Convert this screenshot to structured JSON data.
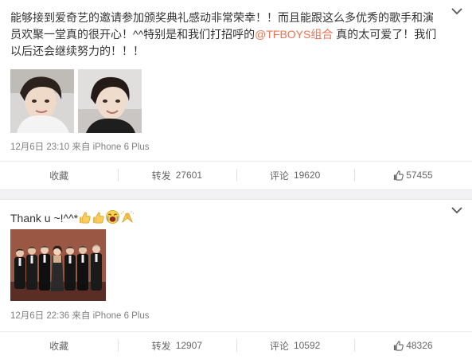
{
  "post1": {
    "text_part1": "能够接到爱奇艺的邀请参加颁奖典礼感动非常荣幸！！而且能跟这么多优秀的歌手和演员欢聚一堂真的很开心！^^特别是和我们打招呼的",
    "mention": "@TFBOYS组合",
    "text_part2": " 真的太可爱了！我们以后还会继续努力的！！！",
    "time": "12月6日 23:10",
    "source": "来自 iPhone 6 Plus",
    "actions": {
      "favorite": "收藏",
      "repost_label": "转发",
      "repost_count": "27601",
      "comment_label": "评论",
      "comment_count": "19620",
      "like_count": "57455"
    }
  },
  "post2": {
    "text": "Thank u ~!^^*",
    "emoji_icons": [
      "thumbs-up-icon",
      "thumbs-up-icon",
      "crying-face-icon",
      "clap-hands-icon"
    ],
    "time": "12月6日 22:36",
    "source": "来自 iPhone 6 Plus",
    "actions": {
      "favorite": "收藏",
      "repost_label": "转发",
      "repost_count": "12907",
      "comment_label": "评论",
      "comment_count": "10592",
      "like_count": "48326"
    }
  },
  "colors": {
    "mention": "#eb7350",
    "meta": "#808080",
    "like": "#eb7350"
  }
}
